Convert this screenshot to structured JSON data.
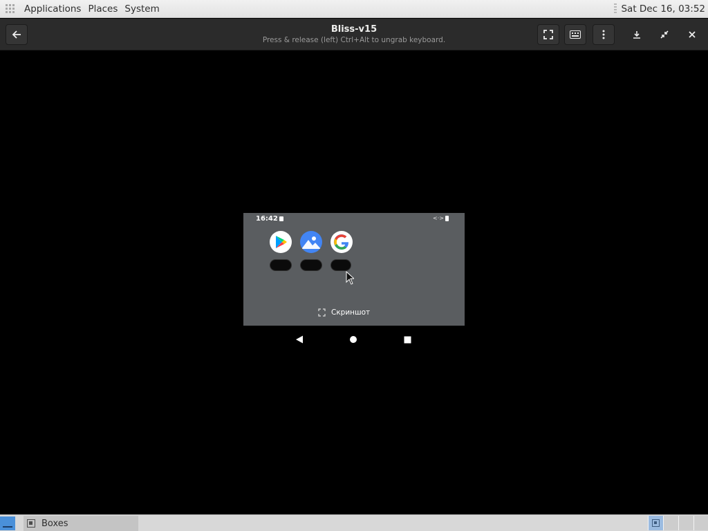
{
  "top_panel": {
    "menus": [
      "Applications",
      "Places",
      "System"
    ],
    "clock": "Sat Dec 16, 03:52"
  },
  "headerbar": {
    "title": "Bliss-v15",
    "subtitle": "Press & release (left) Ctrl+Alt to ungrab keyboard.",
    "buttons": [
      "back-icon",
      "fullscreen-icon",
      "keyboard-icon",
      "menu-icon",
      "download-icon",
      "unfullscreen-icon",
      "close-icon"
    ]
  },
  "android": {
    "status_time": "16:42",
    "apps": [
      "play-store-icon",
      "gallery-icon",
      "google-icon"
    ],
    "screenshot_label": "Скриншот",
    "nav": [
      "back-triangle-icon",
      "home-circle-icon",
      "recents-square-icon"
    ]
  },
  "taskbar": {
    "task_label": "Boxes"
  },
  "colors": {
    "panel_bg": "#e2e2e2",
    "header_bg": "#2b2b2b",
    "android_bg": "#5a5d60",
    "accent": "#4a90d9"
  }
}
